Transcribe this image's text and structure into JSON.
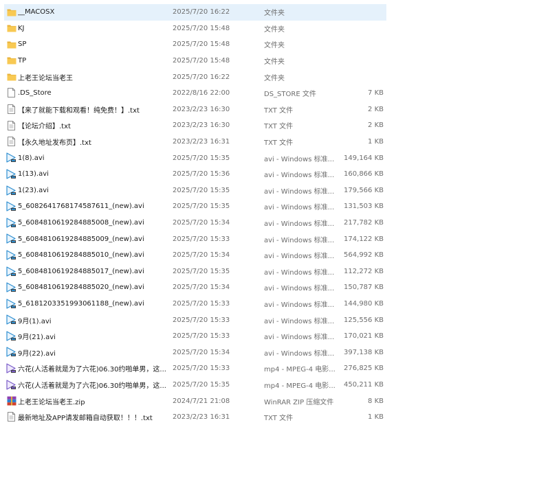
{
  "files": [
    {
      "name": "__MACOSX",
      "date": "2025/7/20 16:22",
      "type": "文件夹",
      "size": "",
      "icon": "folder-icon",
      "selected": true
    },
    {
      "name": "KJ",
      "date": "2025/7/20 15:48",
      "type": "文件夹",
      "size": "",
      "icon": "folder-icon"
    },
    {
      "name": "SP",
      "date": "2025/7/20 15:48",
      "type": "文件夹",
      "size": "",
      "icon": "folder-icon"
    },
    {
      "name": "TP",
      "date": "2025/7/20 15:48",
      "type": "文件夹",
      "size": "",
      "icon": "folder-icon"
    },
    {
      "name": "上老王论坛当老王",
      "date": "2025/7/20 16:22",
      "type": "文件夹",
      "size": "",
      "icon": "folder-icon"
    },
    {
      "name": ".DS_Store",
      "date": "2022/8/16 22:00",
      "type": "DS_STORE 文件",
      "size": "7 KB",
      "icon": "blank-file-icon"
    },
    {
      "name": "【来了就能下载和观看！纯免费！】.txt",
      "date": "2023/2/23 16:30",
      "type": "TXT 文件",
      "size": "2 KB",
      "icon": "text-file-icon"
    },
    {
      "name": "【论坛介绍】.txt",
      "date": "2023/2/23 16:30",
      "type": "TXT 文件",
      "size": "2 KB",
      "icon": "text-file-icon"
    },
    {
      "name": "【永久地址发布页】.txt",
      "date": "2023/2/23 16:31",
      "type": "TXT 文件",
      "size": "1 KB",
      "icon": "text-file-icon"
    },
    {
      "name": "1(8).avi",
      "date": "2025/7/20 15:35",
      "type": "avi - Windows 标准...",
      "size": "149,164 KB",
      "icon": "video-file-icon"
    },
    {
      "name": "1(13).avi",
      "date": "2025/7/20 15:36",
      "type": "avi - Windows 标准...",
      "size": "160,866 KB",
      "icon": "video-file-icon"
    },
    {
      "name": "1(23).avi",
      "date": "2025/7/20 15:35",
      "type": "avi - Windows 标准...",
      "size": "179,566 KB",
      "icon": "video-file-icon"
    },
    {
      "name": "5_6082641768174587611_(new).avi",
      "date": "2025/7/20 15:35",
      "type": "avi - Windows 标准...",
      "size": "131,503 KB",
      "icon": "video-file-icon"
    },
    {
      "name": "5_6084810619284885008_(new).avi",
      "date": "2025/7/20 15:34",
      "type": "avi - Windows 标准...",
      "size": "217,782 KB",
      "icon": "video-file-icon"
    },
    {
      "name": "5_6084810619284885009_(new).avi",
      "date": "2025/7/20 15:33",
      "type": "avi - Windows 标准...",
      "size": "174,122 KB",
      "icon": "video-file-icon"
    },
    {
      "name": "5_6084810619284885010_(new).avi",
      "date": "2025/7/20 15:34",
      "type": "avi - Windows 标准...",
      "size": "564,992 KB",
      "icon": "video-file-icon"
    },
    {
      "name": "5_6084810619284885017_(new).avi",
      "date": "2025/7/20 15:35",
      "type": "avi - Windows 标准...",
      "size": "112,272 KB",
      "icon": "video-file-icon"
    },
    {
      "name": "5_6084810619284885020_(new).avi",
      "date": "2025/7/20 15:34",
      "type": "avi - Windows 标准...",
      "size": "150,787 KB",
      "icon": "video-file-icon"
    },
    {
      "name": "5_6181203351993061188_(new).avi",
      "date": "2025/7/20 15:33",
      "type": "avi - Windows 标准...",
      "size": "144,980 KB",
      "icon": "video-file-icon"
    },
    {
      "name": "9月(1).avi",
      "date": "2025/7/20 15:33",
      "type": "avi - Windows 标准...",
      "size": "125,556 KB",
      "icon": "video-file-icon"
    },
    {
      "name": "9月(21).avi",
      "date": "2025/7/20 15:33",
      "type": "avi - Windows 标准...",
      "size": "170,021 KB",
      "icon": "video-file-icon"
    },
    {
      "name": "9月(22).avi",
      "date": "2025/7/20 15:34",
      "type": "avi - Windows 标准...",
      "size": "397,138 KB",
      "icon": "video-file-icon"
    },
    {
      "name": "六花(人活着就是为了六花)06.30约啪单男，这...",
      "date": "2025/7/20 15:33",
      "type": "mp4 - MPEG-4 电影...",
      "size": "276,825 KB",
      "icon": "mp4-file-icon"
    },
    {
      "name": "六花(人活着就是为了六花)06.30约啪单男，这...",
      "date": "2025/7/20 15:35",
      "type": "mp4 - MPEG-4 电影...",
      "size": "450,211 KB",
      "icon": "mp4-file-icon"
    },
    {
      "name": "上老王论坛当老王.zip",
      "date": "2024/7/21 21:08",
      "type": "WinRAR ZIP 压缩文件",
      "size": "8 KB",
      "icon": "winrar-archive-icon"
    },
    {
      "name": "最新地址及APP请发邮箱自动获取！！！.txt",
      "date": "2023/2/23 16:31",
      "type": "TXT 文件",
      "size": "1 KB",
      "icon": "text-file-icon"
    }
  ],
  "colors": {
    "selected_bg": "#e5f1fb",
    "folder": "#f8c953",
    "folder_dark": "#e8b23a",
    "video": "#2f8fd1",
    "mp4": "#7a5cc9",
    "muted_text": "#6d6d6d"
  }
}
